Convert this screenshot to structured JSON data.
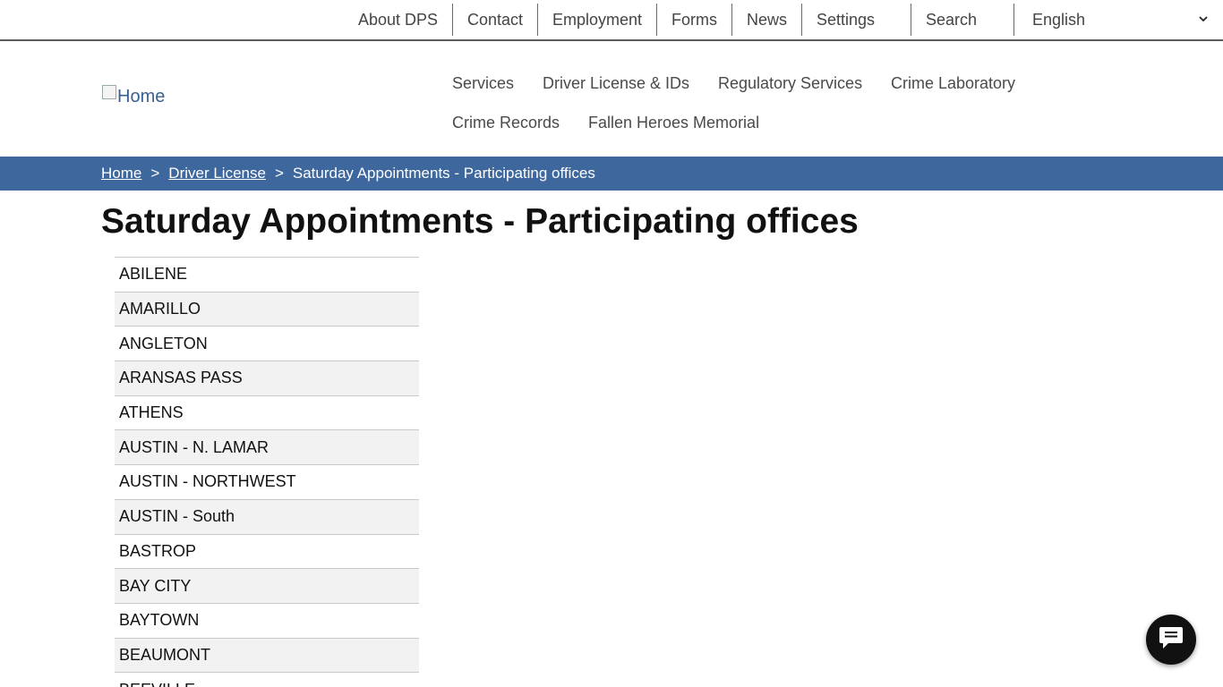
{
  "utility_nav": {
    "about": "About DPS",
    "contact": "Contact",
    "employment": "Employment",
    "forms": "Forms",
    "news": "News",
    "settings": "Settings",
    "search": "Search",
    "language": "English"
  },
  "logo": {
    "alt": "Home"
  },
  "main_nav": [
    "Services",
    "Driver License & IDs",
    "Regulatory Services",
    "Crime Laboratory",
    "Crime Records",
    "Fallen Heroes Memorial"
  ],
  "breadcrumb": {
    "home": "Home",
    "separator": ">",
    "driver_license": "Driver License",
    "current": "Saturday Appointments - Participating offices"
  },
  "page_title": "Saturday Appointments - Participating offices",
  "offices": [
    "ABILENE",
    "AMARILLO",
    "ANGLETON",
    "ARANSAS PASS",
    "ATHENS",
    "AUSTIN - N. LAMAR",
    "AUSTIN - NORTHWEST",
    "AUSTIN - South",
    "BASTROP",
    "BAY CITY",
    "BAYTOWN",
    "BEAUMONT",
    "BEEVILLE"
  ],
  "colors": {
    "breadcrumb_bg": "#3e679e",
    "logo_text": "#3c5f91",
    "chat_bg": "#111111"
  },
  "icons": {
    "chevron": "chevron-down-icon",
    "chat": "chat-bubble-icon"
  }
}
